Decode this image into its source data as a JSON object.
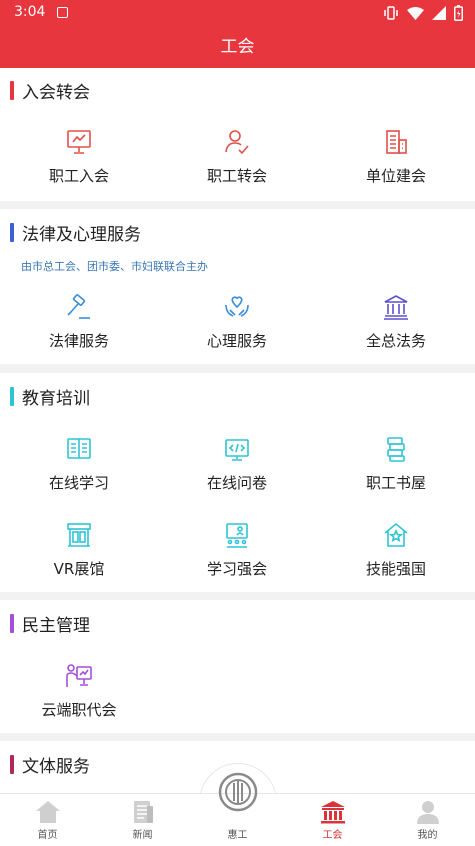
{
  "status_bar": {
    "time": "3:04"
  },
  "header": {
    "title": "工会"
  },
  "sections": [
    {
      "title": "入会转会",
      "accent": "#e8363f",
      "items": [
        {
          "label": "职工入会",
          "icon": "presentation-board-icon"
        },
        {
          "label": "职工转会",
          "icon": "user-check-icon"
        },
        {
          "label": "单位建会",
          "icon": "building-icon"
        }
      ]
    },
    {
      "title": "法律及心理服务",
      "accent": "#3b5fd9",
      "subtitle": "由市总工会、团市委、市妇联联合主办",
      "items": [
        {
          "label": "法律服务",
          "icon": "gavel-icon"
        },
        {
          "label": "心理服务",
          "icon": "heart-hands-icon"
        },
        {
          "label": "全总法务",
          "icon": "courthouse-icon"
        }
      ]
    },
    {
      "title": "教育培训",
      "accent": "#2ec4d6",
      "items": [
        {
          "label": "在线学习",
          "icon": "open-book-icon"
        },
        {
          "label": "在线问卷",
          "icon": "code-window-icon"
        },
        {
          "label": "职工书屋",
          "icon": "book-stack-icon"
        },
        {
          "label": "VR展馆",
          "icon": "exhibition-hall-icon"
        },
        {
          "label": "学习强会",
          "icon": "classroom-icon"
        },
        {
          "label": "技能强国",
          "icon": "star-house-icon"
        }
      ]
    },
    {
      "title": "民主管理",
      "accent": "#a44fd9",
      "items": [
        {
          "label": "云端职代会",
          "icon": "presenter-icon"
        }
      ]
    },
    {
      "title": "文体服务",
      "accent": "#b0295a"
    }
  ],
  "tabbar": {
    "tabs": [
      {
        "label": "首页",
        "icon": "home-icon"
      },
      {
        "label": "新闻",
        "icon": "news-icon"
      },
      {
        "label": "惠工",
        "icon": "union-logo-icon"
      },
      {
        "label": "工会",
        "icon": "institution-icon",
        "active": true
      },
      {
        "label": "我的",
        "icon": "person-icon"
      }
    ]
  },
  "colors": {
    "brand_red": "#e8363f",
    "icon_red": "#e0504a",
    "icon_blue": "#3a8fd8",
    "icon_teal": "#2ec4d6",
    "icon_purple": "#a44fd9"
  }
}
